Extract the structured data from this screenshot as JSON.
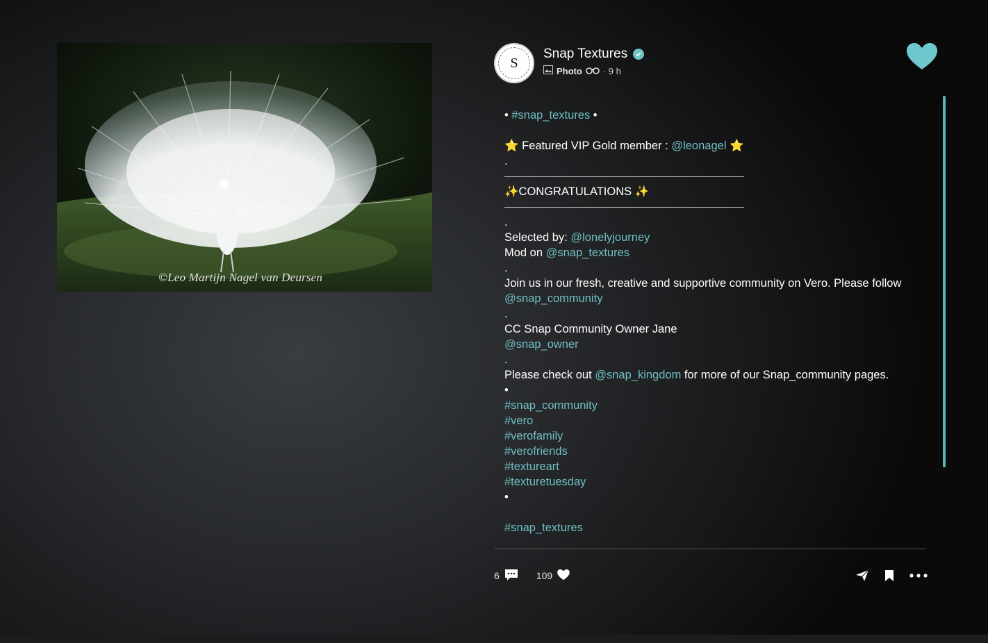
{
  "photo": {
    "credit": "©Leo Martijn Nagel van Deursen"
  },
  "post": {
    "author": "Snap Textures",
    "avatar_letter": "S",
    "type": "Photo",
    "time": "· 9 h"
  },
  "caption": {
    "line1_pre": "• ",
    "line1_tag": "#snap_textures",
    "line1_post": " •",
    "featured_pre": "⭐ Featured VIP Gold member :  ",
    "featured_mention": "@leonagel",
    "featured_post": " ⭐",
    "dot1": ".",
    "congrats": "✨CONGRATULATIONS ✨",
    "dot2": ".",
    "selected_label": "Selected by: ",
    "selected_mention": "@lonelyjourney",
    "mod_label": "Mod on ",
    "mod_mention": "@snap_textures",
    "dot3": ".",
    "join_text": "Join us in our fresh, creative and supportive community on Vero. Please follow ",
    "join_mention": "@snap_community",
    "dot4": ".",
    "cc_text": "CC Snap Community Owner Jane",
    "cc_mention": "@snap_owner",
    "dot5": ".",
    "check_pre": "Please check out ",
    "check_mention": "@snap_kingdom",
    "check_post": " for more of our Snap_community pages.",
    "bullet1": "•",
    "tags": [
      "#snap_community",
      "#vero",
      "#verofamily",
      "#verofriends",
      "#textureart",
      "#texturetuesday"
    ],
    "bullet2": "•",
    "last_tag": "#snap_textures"
  },
  "footer": {
    "comments": "6",
    "likes": "109"
  },
  "colors": {
    "accent": "#6fbfc3",
    "heart": "#6fc8ce"
  }
}
